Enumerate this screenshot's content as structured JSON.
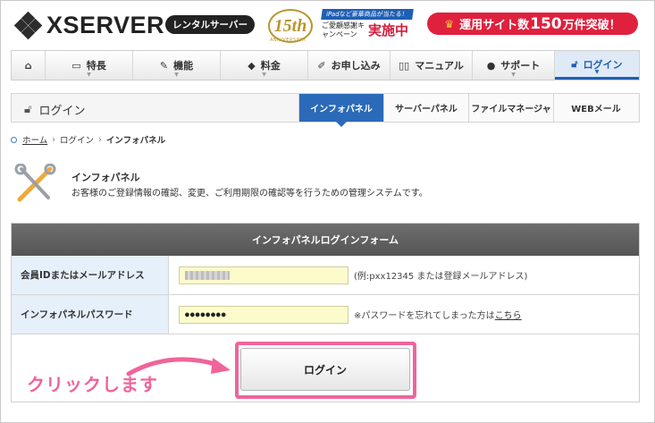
{
  "header": {
    "logo_text": "XSERVER",
    "rental_label": "レンタルサーバー",
    "anniversary_number": "15th",
    "anniversary_sub": "ANNIVERSARY",
    "anniversary_top": "iPadなど豪華商品が当たる！",
    "anniversary_mid": "ご愛顧感謝キャンペーン",
    "anniversary_big": "実施中",
    "promo_prefix": "運用サイト数",
    "promo_number": "150",
    "promo_suffix": "万件突破！"
  },
  "nav": {
    "items": [
      {
        "label": "",
        "icon": "home-icon"
      },
      {
        "label": "特長",
        "icon": "monitor-icon"
      },
      {
        "label": "機能",
        "icon": "tools-icon"
      },
      {
        "label": "料金",
        "icon": "tag-icon"
      },
      {
        "label": "お申し込み",
        "icon": "pen-icon"
      },
      {
        "label": "マニュアル",
        "icon": "book-icon"
      },
      {
        "label": "サポート",
        "icon": "user-icon"
      },
      {
        "label": "ログイン",
        "icon": "lock-icon",
        "active": true
      }
    ]
  },
  "subheader": {
    "title": "ログイン",
    "tabs": [
      {
        "label": "インフォパネル",
        "active": true
      },
      {
        "label": "サーバーパネル"
      },
      {
        "label": "ファイルマネージャ"
      },
      {
        "label": "WEBメール"
      }
    ]
  },
  "breadcrumb": {
    "home": "ホーム",
    "login": "ログイン",
    "current": "インフォパネル"
  },
  "intro": {
    "title": "インフォパネル",
    "description": "お客様のご登録情報の確認、変更、ご利用期限の確認等を行うための管理システムです。"
  },
  "form": {
    "heading": "インフォパネルログインフォーム",
    "id_label": "会員IDまたはメールアドレス",
    "id_hint": "(例:pxx12345 または登録メールアドレス)",
    "password_label": "インフォパネルパスワード",
    "password_value": "●●●●●●●●",
    "password_hint": "※パスワードを忘れてしまった方は",
    "password_link": "こちら",
    "login_button": "ログイン"
  },
  "annotation": {
    "text": "クリックします"
  },
  "colors": {
    "accent_blue": "#2a6ab8",
    "highlight_pink": "#f0649b",
    "promo_red": "#e0213e"
  }
}
